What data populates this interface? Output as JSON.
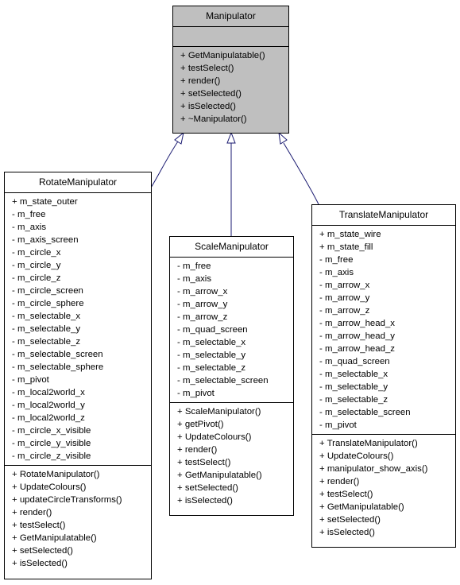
{
  "colors": {
    "base_fill": "#bfbfbf",
    "edge": "#191970"
  },
  "classes": {
    "manipulator": {
      "name": "Manipulator",
      "attributes": [],
      "methods": [
        "+ GetManipulatable()",
        "+ testSelect()",
        "+ render()",
        "+ setSelected()",
        "+ isSelected()",
        "+ ~Manipulator()"
      ]
    },
    "rotate": {
      "name": "RotateManipulator",
      "attributes": [
        "+ m_state_outer",
        "- m_free",
        "- m_axis",
        "- m_axis_screen",
        "- m_circle_x",
        "- m_circle_y",
        "- m_circle_z",
        "- m_circle_screen",
        "- m_circle_sphere",
        "- m_selectable_x",
        "- m_selectable_y",
        "- m_selectable_z",
        "- m_selectable_screen",
        "- m_selectable_sphere",
        "- m_pivot",
        "- m_local2world_x",
        "- m_local2world_y",
        "- m_local2world_z",
        "- m_circle_x_visible",
        "- m_circle_y_visible",
        "- m_circle_z_visible"
      ],
      "methods": [
        "+ RotateManipulator()",
        "+ UpdateColours()",
        "+ updateCircleTransforms()",
        "+ render()",
        "+ testSelect()",
        "+ GetManipulatable()",
        "+ setSelected()",
        "+ isSelected()"
      ]
    },
    "scale": {
      "name": "ScaleManipulator",
      "attributes": [
        "- m_free",
        "- m_axis",
        "- m_arrow_x",
        "- m_arrow_y",
        "- m_arrow_z",
        "- m_quad_screen",
        "- m_selectable_x",
        "- m_selectable_y",
        "- m_selectable_z",
        "- m_selectable_screen",
        "- m_pivot"
      ],
      "methods": [
        "+ ScaleManipulator()",
        "+ getPivot()",
        "+ UpdateColours()",
        "+ render()",
        "+ testSelect()",
        "+ GetManipulatable()",
        "+ setSelected()",
        "+ isSelected()"
      ]
    },
    "translate": {
      "name": "TranslateManipulator",
      "attributes": [
        "+ m_state_wire",
        "+ m_state_fill",
        "- m_free",
        "- m_axis",
        "- m_arrow_x",
        "- m_arrow_y",
        "- m_arrow_z",
        "- m_arrow_head_x",
        "- m_arrow_head_y",
        "- m_arrow_head_z",
        "- m_quad_screen",
        "- m_selectable_x",
        "- m_selectable_y",
        "- m_selectable_z",
        "- m_selectable_screen",
        "- m_pivot"
      ],
      "methods": [
        "+ TranslateManipulator()",
        "+ UpdateColours()",
        "+ manipulator_show_axis()",
        "+ render()",
        "+ testSelect()",
        "+ GetManipulatable()",
        "+ setSelected()",
        "+ isSelected()"
      ]
    }
  },
  "relations": [
    {
      "from": "RotateManipulator",
      "to": "Manipulator",
      "type": "inheritance"
    },
    {
      "from": "ScaleManipulator",
      "to": "Manipulator",
      "type": "inheritance"
    },
    {
      "from": "TranslateManipulator",
      "to": "Manipulator",
      "type": "inheritance"
    }
  ]
}
